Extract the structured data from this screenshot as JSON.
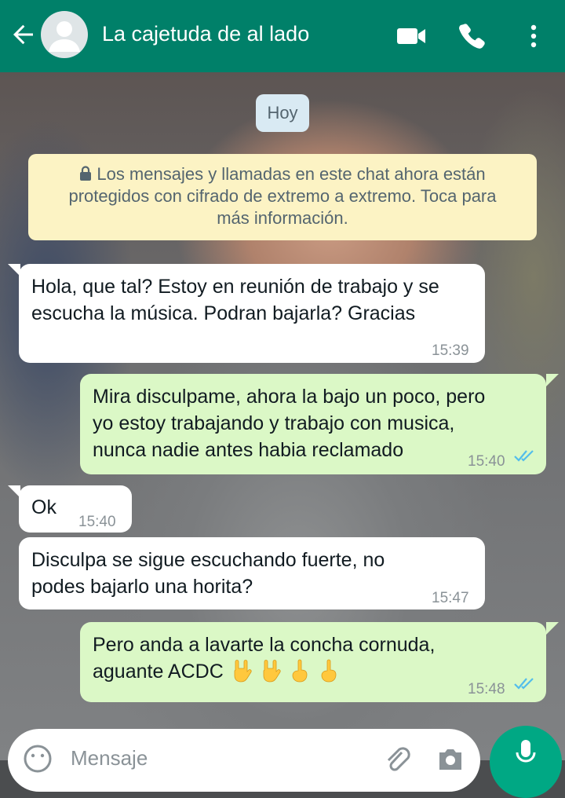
{
  "header": {
    "title": "La cajetuda de al lado",
    "icons": [
      "back-arrow-icon",
      "avatar-icon",
      "video-call-icon",
      "phone-icon",
      "more-vertical-icon"
    ],
    "color": "#008069"
  },
  "chat": {
    "date_chip": "Hoy",
    "encryption_notice": {
      "line1": "Los mensajes y llamadas en este chat ahora están",
      "line2": "protegidos con cifrado de extremo a extremo. Toca para",
      "line3": "más información."
    },
    "messages": [
      {
        "direction": "incoming",
        "lines": [
          "Hola, que tal? Estoy en reunión de trabajo y se",
          "escucha la música. Podran bajarla? Gracias"
        ],
        "time": "15:39"
      },
      {
        "direction": "outgoing",
        "lines": [
          "Mira disculpame, ahora la bajo un poco, pero",
          "yo estoy trabajando y trabajo con musica,",
          "nunca nadie antes habia reclamado"
        ],
        "time": "15:40",
        "status": "read"
      },
      {
        "direction": "incoming",
        "lines": [
          "Ok"
        ],
        "time": "15:40"
      },
      {
        "direction": "incoming",
        "lines": [
          "Disculpa se sigue escuchando fuerte, no",
          "podes bajarlo una horita?"
        ],
        "time": "15:47"
      },
      {
        "direction": "outgoing",
        "lines": [
          "Pero anda a lavarte la concha cornuda,",
          "aguante ACDC"
        ],
        "time": "15:48",
        "status": "read",
        "emojis": [
          "sign-of-the-horns",
          "sign-of-the-horns",
          "middle-finger",
          "middle-finger"
        ]
      }
    ]
  },
  "composer": {
    "placeholder": "Mensaje",
    "icons": [
      "emoji-icon",
      "attach-icon",
      "camera-icon",
      "mic-icon"
    ]
  },
  "colors": {
    "incoming_bubble": "#ffffff",
    "outgoing_bubble": "#dbf8c6",
    "read_ticks": "#53bdeb",
    "notice_bg": "#fcf3c4",
    "date_chip_bg": "#d9eaf3"
  }
}
